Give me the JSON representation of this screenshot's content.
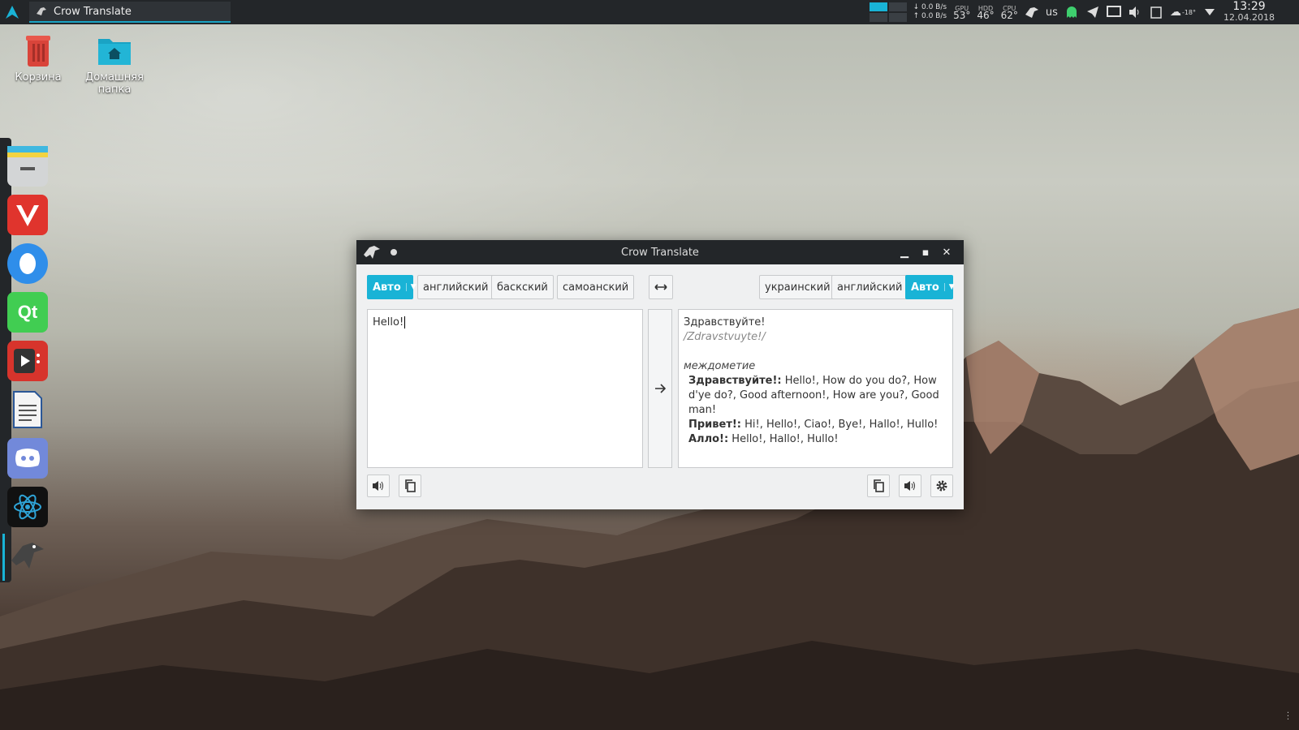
{
  "taskbar": {
    "task_title": "Crow Translate",
    "net_down": "0.0 B/s",
    "net_up": "0.0 B/s",
    "gpu_label": "GPU",
    "gpu_value": "53°",
    "hdd_label": "HDD",
    "hdd_value": "46°",
    "cpu_label": "CPU",
    "cpu_value": "62°",
    "keyboard_layout": "us",
    "weather_temp": "-18°",
    "time": "13:29",
    "date": "12.04.2018"
  },
  "desktop": {
    "trash_label": "Корзина",
    "home_label": "Домашняя папка"
  },
  "window": {
    "title": "Crow Translate",
    "source_langs": [
      "Авто",
      "английский",
      "баскский",
      "самоанский"
    ],
    "target_langs": [
      "украинский",
      "английский",
      "Авто"
    ],
    "source_text": "Hello!",
    "translation": {
      "main": "Здравствуйте!",
      "transliteration": "/Zdravstvuyte!/",
      "part_of_speech": "междометие",
      "entries": [
        {
          "word": "Здравствуйте!:",
          "meanings": " Hello!, How do you do?, How d'ye do?, Good afternoon!, How are you?, Good man!"
        },
        {
          "word": "Привет!:",
          "meanings": " Hi!, Hello!, Ciao!, Bye!, Hallo!, Hullo!"
        },
        {
          "word": "Алло!:",
          "meanings": " Hello!, Hallo!, Hullo!"
        }
      ]
    }
  },
  "colors": {
    "accent": "#19b3d6",
    "panel": "#232629"
  }
}
